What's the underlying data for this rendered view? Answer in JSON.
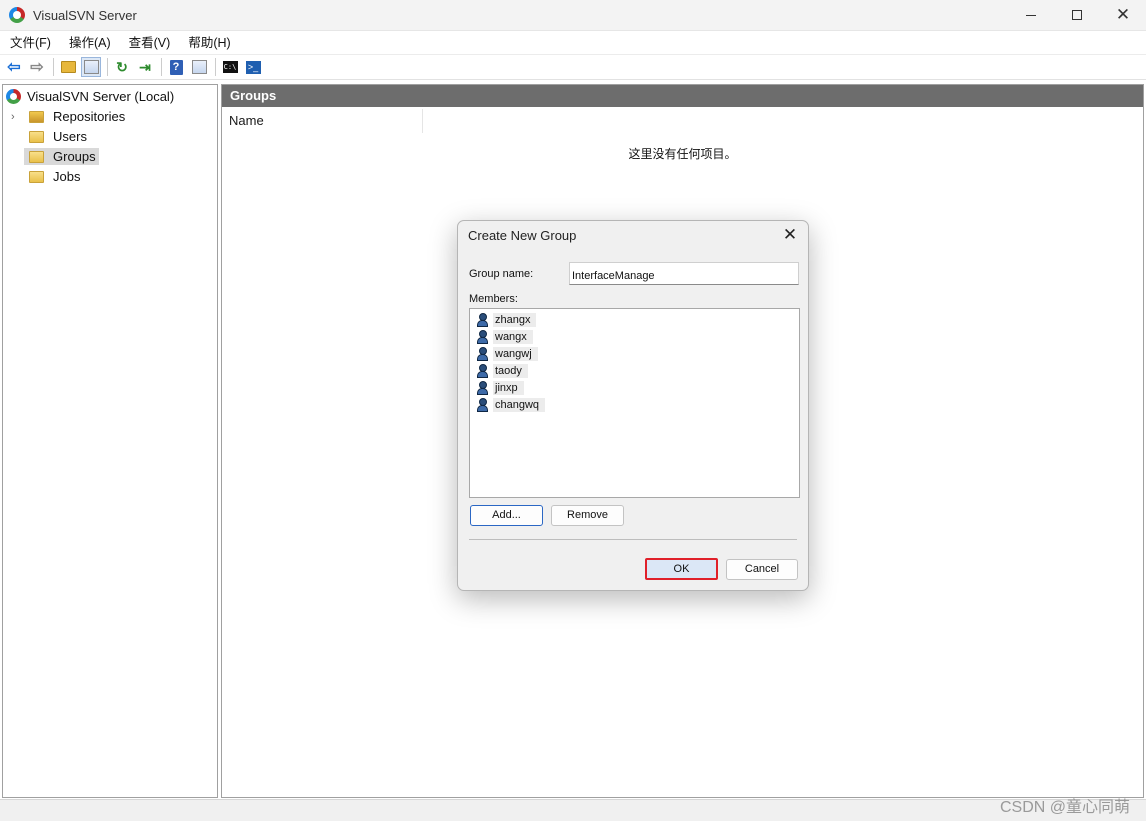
{
  "window": {
    "title": "VisualSVN Server"
  },
  "menubar": {
    "items": [
      "文件(F)",
      "操作(A)",
      "查看(V)",
      "帮助(H)"
    ]
  },
  "toolbar": {
    "buttons": [
      "back-icon",
      "forward-icon",
      "up-folder-icon",
      "show-hide-tree-icon",
      "refresh-icon",
      "export-list-icon",
      "help-icon",
      "properties-icon",
      "command-prompt-icon",
      "powershell-icon"
    ]
  },
  "tree": {
    "root": "VisualSVN Server (Local)",
    "items": [
      "Repositories",
      "Users",
      "Groups",
      "Jobs"
    ],
    "selected": "Groups"
  },
  "main": {
    "header": "Groups",
    "column_name": "Name",
    "empty_message": "这里没有任何项目。"
  },
  "dialog": {
    "title": "Create New Group",
    "group_name_label": "Group name:",
    "group_name_value": "InterfaceManage",
    "members_label": "Members:",
    "members": [
      "zhangx",
      "wangx",
      "wangwj",
      "taody",
      "jinxp",
      "changwq"
    ],
    "add_label": "Add...",
    "remove_label": "Remove",
    "ok_label": "OK",
    "cancel_label": "Cancel"
  },
  "watermark": "CSDN @童心同萌"
}
